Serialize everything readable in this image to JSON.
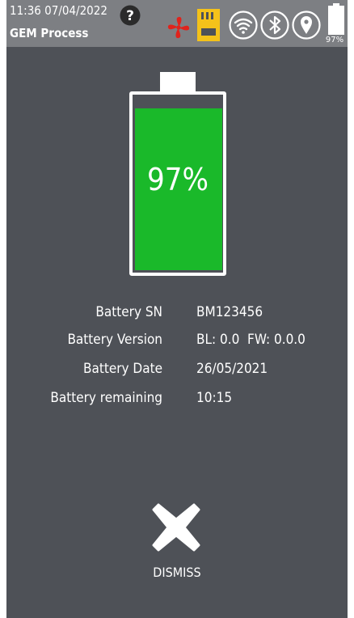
{
  "status_bar": {
    "datetime": "11:36 07/04/2022",
    "process": "GEM Process",
    "battery_percent_label": "97%",
    "icons": [
      "help-icon",
      "fan-icon",
      "sd-card-icon",
      "wifi-icon",
      "bluetooth-icon",
      "location-icon",
      "battery-icon"
    ],
    "colors": {
      "fan": "#e0231c",
      "sd_card": "#f4c21a"
    }
  },
  "battery": {
    "percent_label": "97%",
    "level": 0.97,
    "fill_color": "#1ab92a"
  },
  "info": [
    {
      "label": "Battery SN",
      "value": "BM123456"
    },
    {
      "label": "Battery Version",
      "value": "BL: 0.0  FW: 0.0.0"
    },
    {
      "label": "Battery Date",
      "value": "26/05/2021"
    },
    {
      "label": "Battery remaining",
      "value": "10:15"
    }
  ],
  "dismiss": {
    "label": "DISMISS",
    "icon": "close-icon"
  }
}
